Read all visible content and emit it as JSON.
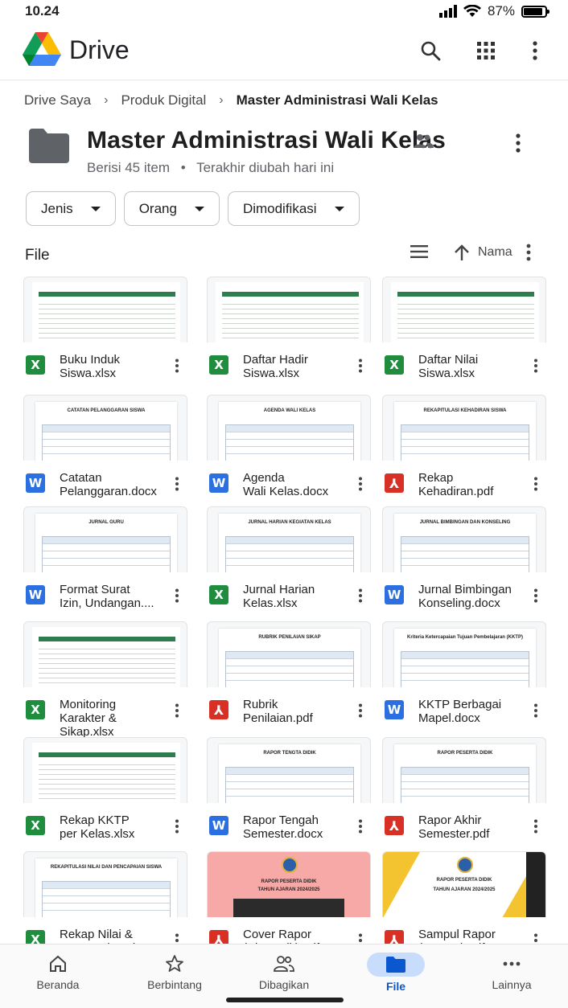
{
  "status": {
    "time": "10.24",
    "battery": "87%"
  },
  "app": {
    "title": "Drive"
  },
  "breadcrumb": {
    "items": [
      "Drive Saya",
      "Produk Digital",
      "Master Administrasi Wali Kelas"
    ]
  },
  "folder": {
    "title": "Master Administrasi Wali Kelas",
    "count": "Berisi 45 item",
    "separator": "•",
    "modified": "Terakhir diubah hari ini"
  },
  "filters": [
    "Jenis",
    "Orang",
    "Dimodifikasi"
  ],
  "section": {
    "label": "File",
    "sort_label": "Nama"
  },
  "files": [
    {
      "name_line1": "Buku Induk",
      "name_line2": "Siswa.xlsx",
      "type": "xlsx",
      "icon_letter": "X"
    },
    {
      "name_line1": "Daftar Hadir",
      "name_line2": "Siswa.xlsx",
      "type": "xlsx",
      "icon_letter": "X"
    },
    {
      "name_line1": "Daftar Nilai",
      "name_line2": "Siswa.xlsx",
      "type": "xlsx",
      "icon_letter": "X"
    },
    {
      "name_line1": "Catatan",
      "name_line2": "Pelanggaran.docx",
      "type": "docx",
      "icon_letter": "W",
      "thumb_title": "CATATAN PELANGGARAN SISWA"
    },
    {
      "name_line1": "Agenda",
      "name_line2": "Wali Kelas.docx",
      "type": "docx",
      "icon_letter": "W",
      "thumb_title": "AGENDA WALI KELAS"
    },
    {
      "name_line1": "Rekap",
      "name_line2": "Kehadiran.pdf",
      "type": "pdf",
      "icon_letter": "⅄",
      "thumb_title": "REKAPITULASI KEHADIRAN SISWA"
    },
    {
      "name_line1": "Format Surat",
      "name_line2": "Izin, Undangan....",
      "type": "docx",
      "icon_letter": "W",
      "thumb_title": "JURNAL GURU"
    },
    {
      "name_line1": "Jurnal Harian",
      "name_line2": "Kelas.xlsx",
      "type": "xlsx",
      "icon_letter": "X",
      "thumb_title": "JURNAL HARIAN KEGIATAN KELAS"
    },
    {
      "name_line1": "Jurnal Bimbingan",
      "name_line2": "Konseling.docx",
      "type": "docx",
      "icon_letter": "W",
      "thumb_title": "JURNAL BIMBINGAN DAN KONSELING"
    },
    {
      "name_line1": "Monitoring",
      "name_line2": "Karakter & Sikap.xlsx",
      "type": "xlsx",
      "icon_letter": "X"
    },
    {
      "name_line1": "Rubrik",
      "name_line2": "Penilaian.pdf",
      "type": "pdf",
      "icon_letter": "⅄",
      "thumb_title": "RUBRIK PENILAIAN SIKAP"
    },
    {
      "name_line1": "KKTP Berbagai",
      "name_line2": "Mapel.docx",
      "type": "docx",
      "icon_letter": "W",
      "thumb_title": "Kriteria Ketercapaian Tujuan Pembelajaran (KKTP)"
    },
    {
      "name_line1": "Rekap KKTP",
      "name_line2": "per Kelas.xlsx",
      "type": "xlsx",
      "icon_letter": "X"
    },
    {
      "name_line1": "Rapor Tengah",
      "name_line2": "Semester.docx",
      "type": "docx",
      "icon_letter": "W",
      "thumb_title": "RAPOR TENGTA DIDIK"
    },
    {
      "name_line1": "Rapor Akhir",
      "name_line2": "Semester.pdf",
      "type": "pdf",
      "icon_letter": "⅄",
      "thumb_title": "RAPOR PESERTA DIDIK"
    },
    {
      "name_line1": "Rekap Nilai &",
      "name_line2": "Pencapaian.xlsx",
      "type": "xlsx",
      "icon_letter": "X",
      "thumb_title": "REKAPITULASI NILAI DAN PENCAPAIAN SISWA"
    },
    {
      "name_line1": "Cover Rapor",
      "name_line2": "(Siap Edit).pdf",
      "type": "pdf",
      "icon_letter": "⅄",
      "thumb_title": "RAPOR PESERTA DIDIK",
      "thumb_sub": "TAHUN AJARAN 2024/2025"
    },
    {
      "name_line1": "Sampul Rapor",
      "name_line2": "(Format).pdf",
      "type": "pdf",
      "icon_letter": "⅄",
      "thumb_title": "RAPOR PESERTA DIDIK",
      "thumb_sub": "TAHUN AJARAN 2024/2025"
    }
  ],
  "nav": [
    {
      "label": "Beranda",
      "icon": "home-icon"
    },
    {
      "label": "Berbintang",
      "icon": "star-icon"
    },
    {
      "label": "Dibagikan",
      "icon": "people-icon"
    },
    {
      "label": "File",
      "icon": "folder-icon",
      "active": true
    },
    {
      "label": "Lainnya",
      "icon": "more-horiz-icon"
    }
  ],
  "colors": {
    "xlsx": "#1e8e3e",
    "docx": "#2b6fe0",
    "pdf": "#d93025",
    "active": "#0b57d0"
  }
}
